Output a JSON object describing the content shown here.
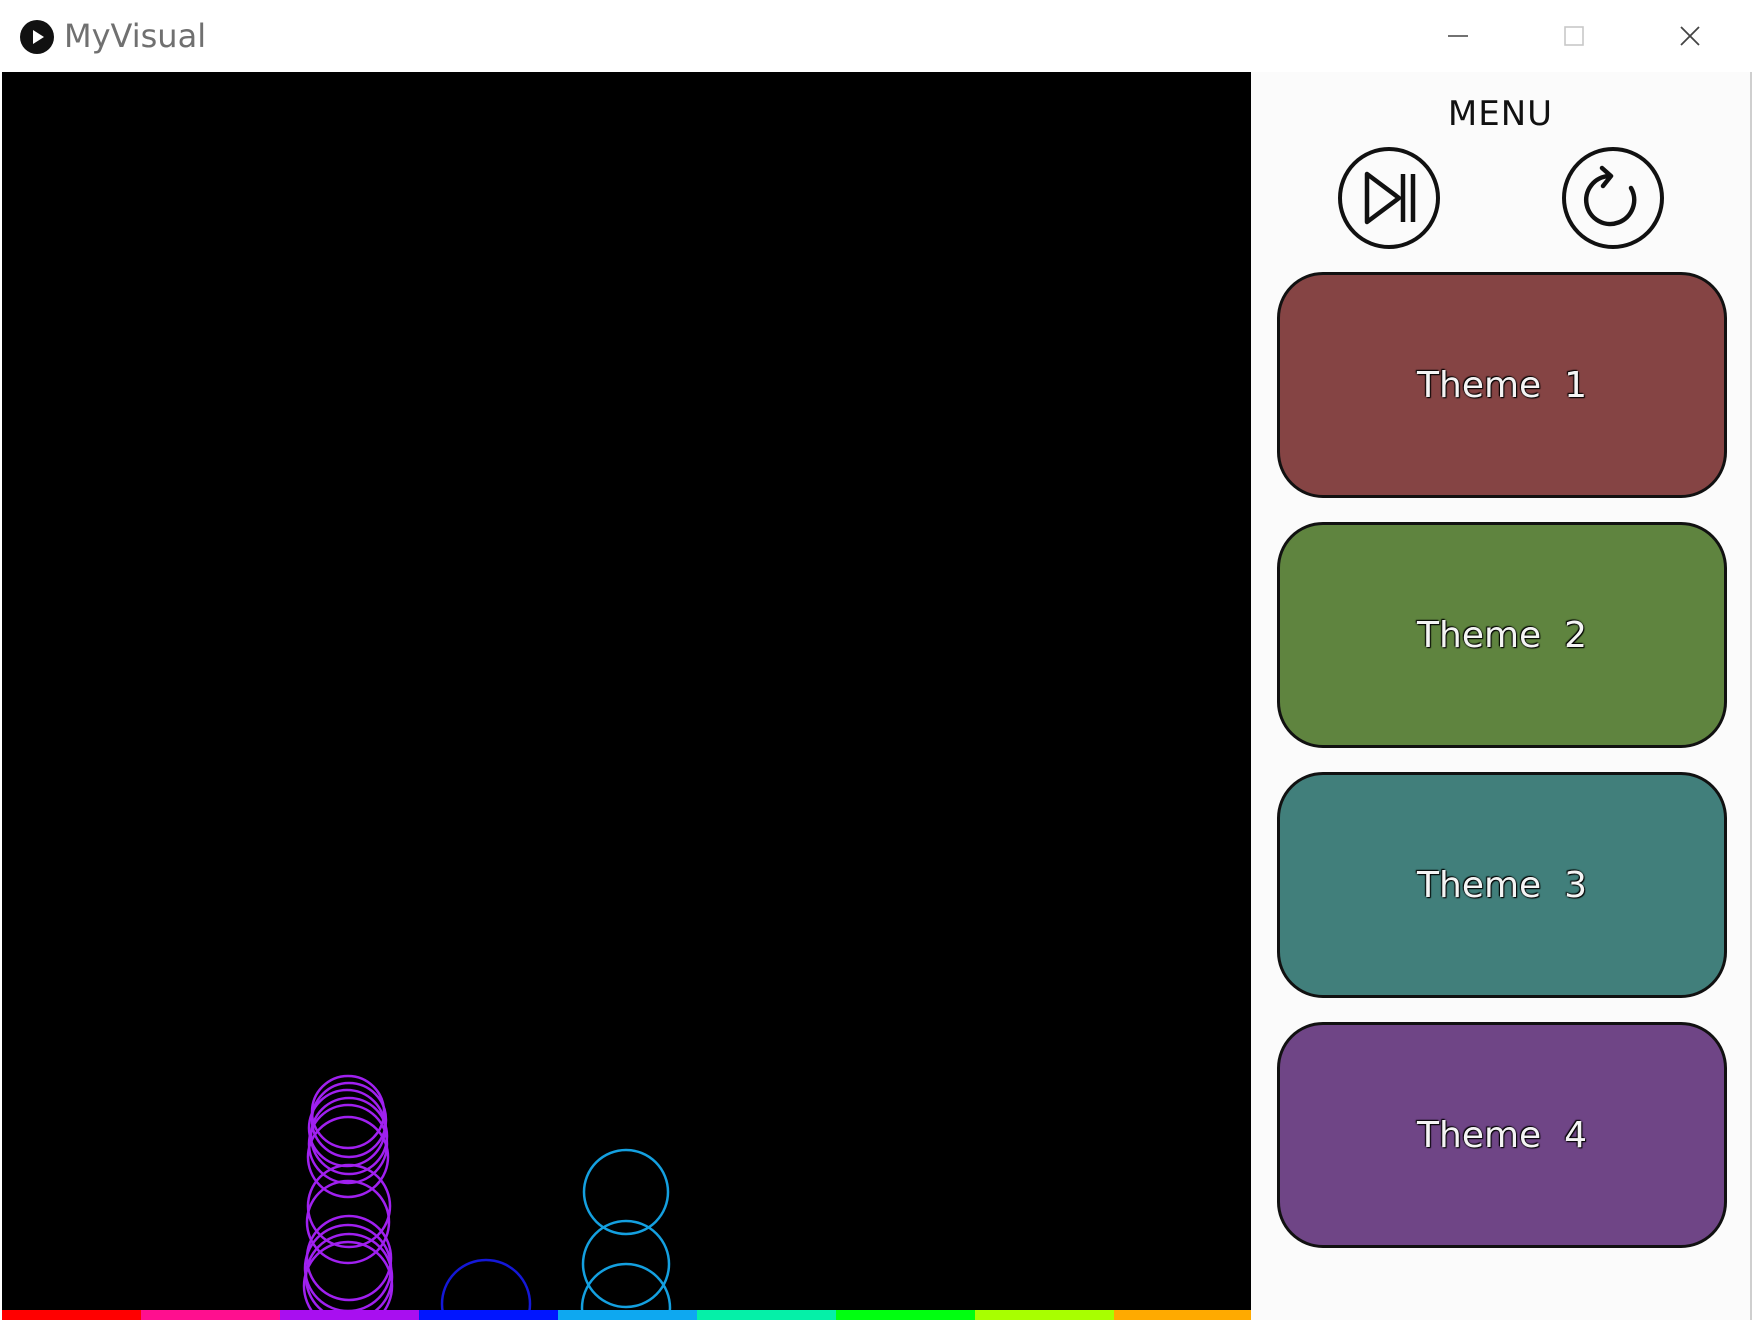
{
  "window": {
    "title": "MyVisual"
  },
  "menu": {
    "title": "MENU",
    "play_button_icon": "play-pause-icon",
    "reset_button_icon": "restart-icon"
  },
  "themes": [
    {
      "label": "Theme  1",
      "color": "#854444"
    },
    {
      "label": "Theme  2",
      "color": "#5f843f"
    },
    {
      "label": "Theme  3",
      "color": "#417f7b"
    },
    {
      "label": "Theme  4",
      "color": "#6f4586"
    }
  ],
  "visual": {
    "bottom_bar_colors": [
      "#ff0000",
      "#ff0f8f",
      "#a80ff0",
      "#0015ff",
      "#0ea8f0",
      "#05f0a8",
      "#00ff10",
      "#a8ff00",
      "#ffaa00"
    ]
  }
}
